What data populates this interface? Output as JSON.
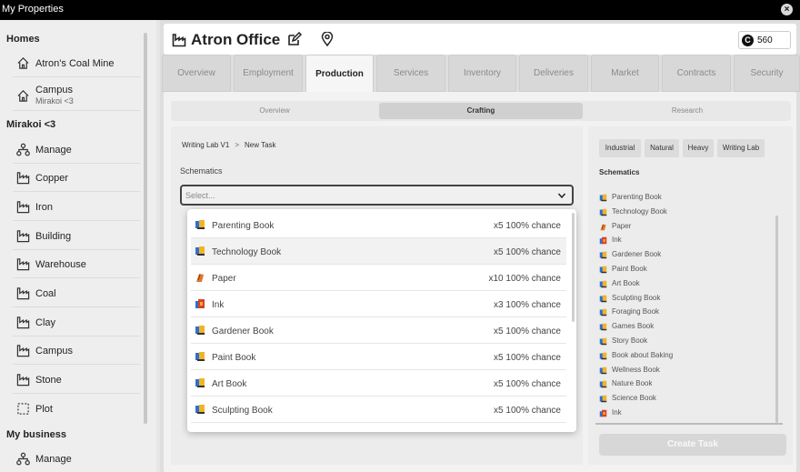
{
  "window": {
    "title": "My Properties"
  },
  "sidebar": {
    "homes_header": "Homes",
    "homes": [
      {
        "label": "Atron's Coal Mine",
        "icon": "house-icon"
      },
      {
        "label": "Campus",
        "sub": "Mirakoi <3",
        "icon": "house-icon"
      }
    ],
    "group_header": "Mirakoi <3",
    "group_items": [
      {
        "label": "Manage",
        "icon": "org-chart-icon"
      },
      {
        "label": "Copper",
        "icon": "factory-icon"
      },
      {
        "label": "Iron",
        "icon": "factory-icon"
      },
      {
        "label": "Building",
        "icon": "factory-icon"
      },
      {
        "label": "Warehouse",
        "icon": "factory-icon"
      },
      {
        "label": "Coal",
        "icon": "factory-icon"
      },
      {
        "label": "Clay",
        "icon": "factory-icon"
      },
      {
        "label": "Campus",
        "icon": "factory-icon"
      },
      {
        "label": "Stone",
        "icon": "factory-icon"
      },
      {
        "label": "Plot",
        "icon": "dashed-square-icon"
      }
    ],
    "business_header": "My business",
    "business_items": [
      {
        "label": "Manage",
        "icon": "org-chart-icon"
      }
    ]
  },
  "header": {
    "title": "Atron Office",
    "currency_value": "560"
  },
  "tabs": [
    "Overview",
    "Employment",
    "Production",
    "Services",
    "Inventory",
    "Deliveries",
    "Market",
    "Contracts",
    "Security"
  ],
  "active_tab": "Production",
  "subtabs": [
    "Overview",
    "Crafting",
    "Research"
  ],
  "active_subtab": "Crafting",
  "breadcrumb": {
    "first": "Writing Lab V1",
    "sep": ">",
    "second": "New Task"
  },
  "schematics_label": "Schematics",
  "select_placeholder": "Select...",
  "dropdown_items": [
    {
      "name": "Parenting Book",
      "qty": "x5 100% chance",
      "icon": "book-icon"
    },
    {
      "name": "Technology Book",
      "qty": "x5 100% chance",
      "icon": "book-icon"
    },
    {
      "name": "Paper",
      "qty": "x10 100% chance",
      "icon": "paper-icon"
    },
    {
      "name": "Ink",
      "qty": "x3 100% chance",
      "icon": "ink-icon"
    },
    {
      "name": "Gardener Book",
      "qty": "x5 100% chance",
      "icon": "book-icon"
    },
    {
      "name": "Paint Book",
      "qty": "x5 100% chance",
      "icon": "book-icon"
    },
    {
      "name": "Art Book",
      "qty": "x5 100% chance",
      "icon": "book-icon"
    },
    {
      "name": "Sculpting Book",
      "qty": "x5 100% chance",
      "icon": "book-icon"
    }
  ],
  "categories": [
    "Industrial",
    "Natural",
    "Heavy",
    "Writing Lab"
  ],
  "right_schematics_label": "Schematics",
  "schematic_list": [
    {
      "name": "Parenting Book",
      "icon": "book-icon"
    },
    {
      "name": "Technology Book",
      "icon": "book-icon"
    },
    {
      "name": "Paper",
      "icon": "paper-icon"
    },
    {
      "name": "Ink",
      "icon": "ink-icon"
    },
    {
      "name": "Gardener Book",
      "icon": "book-icon"
    },
    {
      "name": "Paint Book",
      "icon": "book-icon"
    },
    {
      "name": "Art Book",
      "icon": "book-icon"
    },
    {
      "name": "Sculpting Book",
      "icon": "book-icon"
    },
    {
      "name": "Foraging Book",
      "icon": "book-icon"
    },
    {
      "name": "Games Book",
      "icon": "book-icon"
    },
    {
      "name": "Story Book",
      "icon": "book-icon"
    },
    {
      "name": "Book about Baking",
      "icon": "book-icon"
    },
    {
      "name": "Wellness Book",
      "icon": "book-icon"
    },
    {
      "name": "Nature Book",
      "icon": "book-icon"
    },
    {
      "name": "Science Book",
      "icon": "book-icon"
    },
    {
      "name": "Ink",
      "icon": "ink-icon"
    }
  ],
  "create_button": "Create Task",
  "colors": {
    "titlebar": "#000000",
    "book_blue": "#2f6fd1",
    "book_yellow": "#f0b429",
    "ink_red": "#d9412b",
    "paper_orange": "#e0772c"
  }
}
